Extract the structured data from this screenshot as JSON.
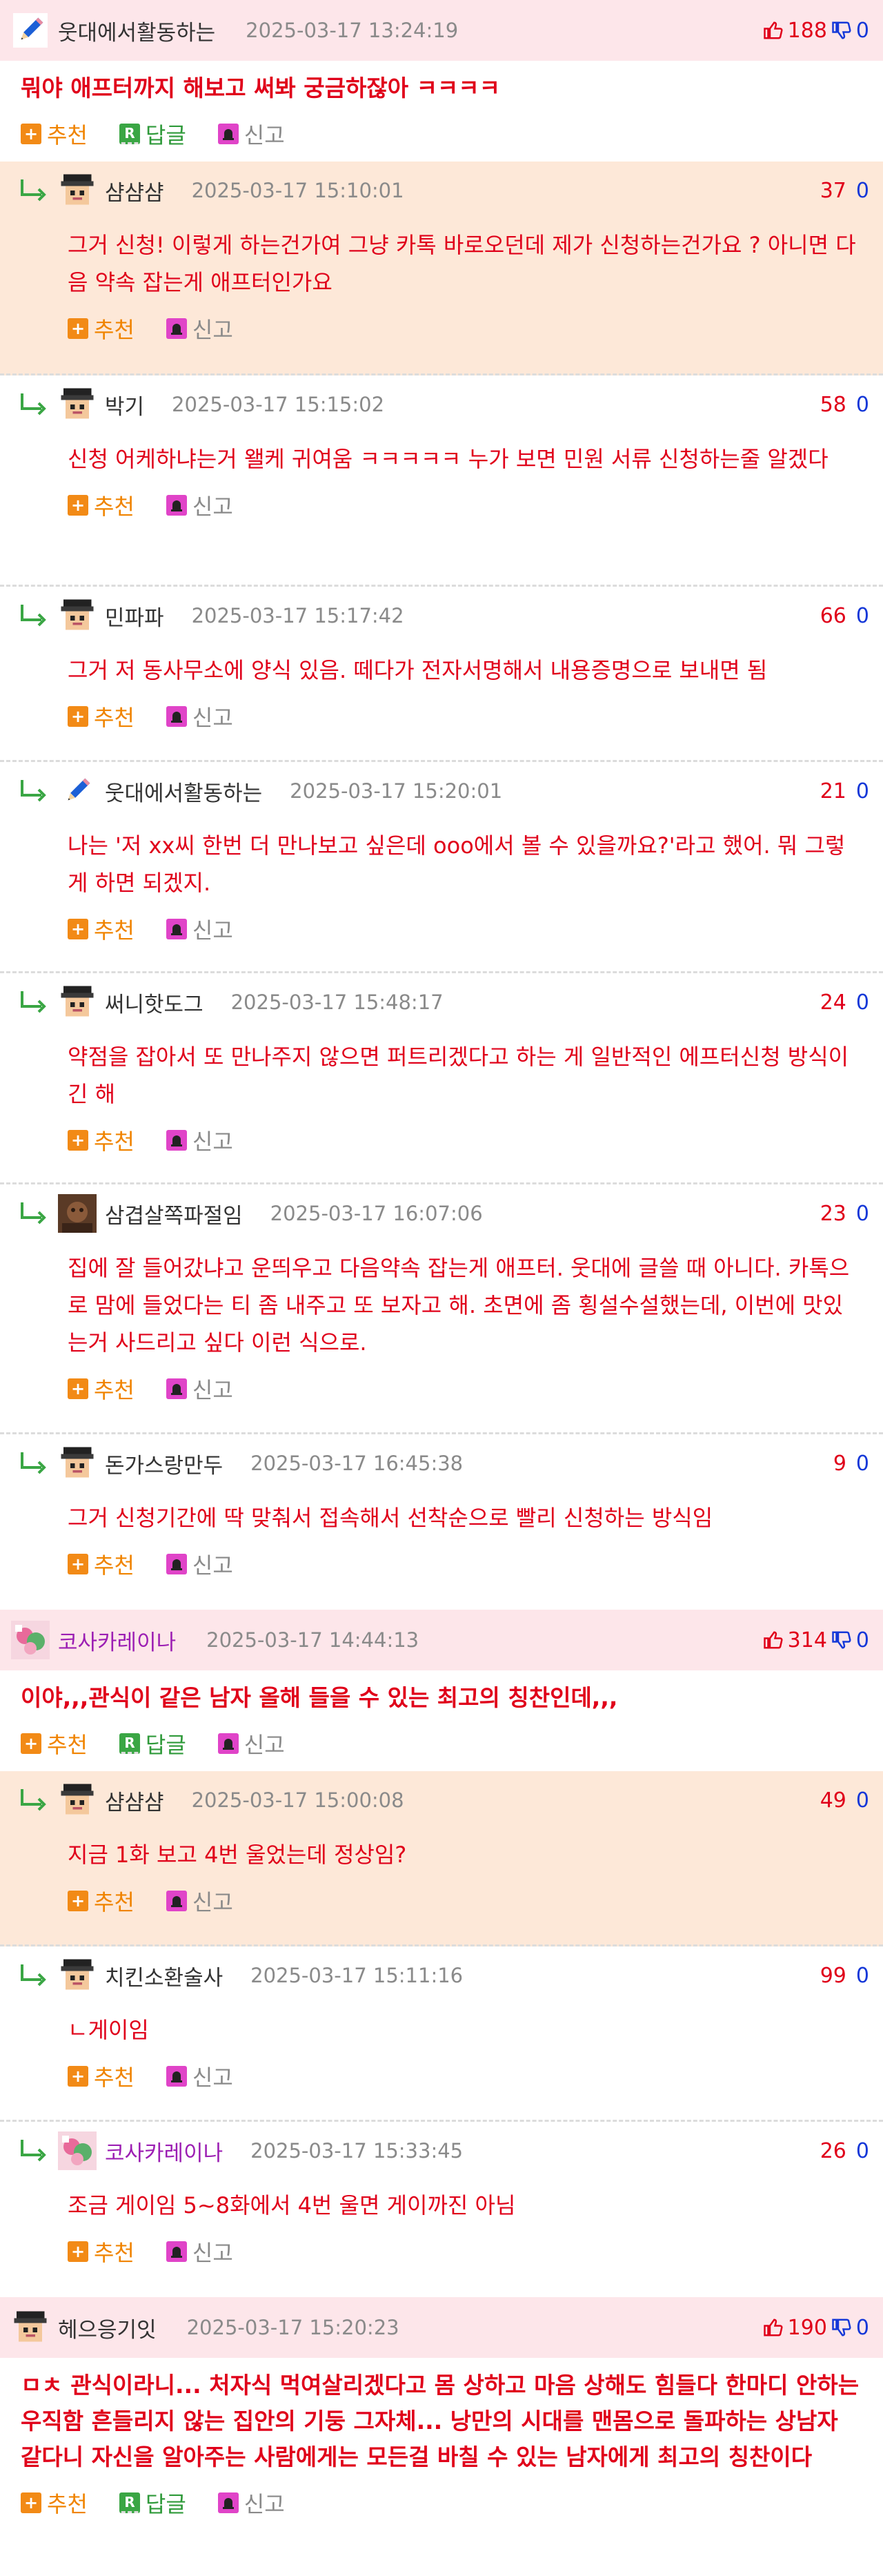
{
  "labels": {
    "recommend": "추천",
    "reply": "답글",
    "report": "신고",
    "reply_icon": "R"
  },
  "threads": [
    {
      "nick": "웃대에서활동하는",
      "date": "2025-03-17 13:24:19",
      "up": "188",
      "down": "0",
      "avatar_icon": "pencil-icon",
      "text": "뭐야 애프터까지 해보고 써봐 궁금하잖아 ㅋㅋㅋㅋ",
      "replies": [
        {
          "nick": "샴샴샴",
          "date": "2025-03-17 15:10:01",
          "up": "37",
          "down": "0",
          "avatar_icon": "pixel-face-icon",
          "text": "그거 신청! 이렇게 하는건가여 그냥 카톡 바로오던데 제가 신청하는건가요 ? 아니면 다음 약속 잡는게 애프터인가요"
        },
        {
          "nick": "박기",
          "date": "2025-03-17 15:15:02",
          "up": "58",
          "down": "0",
          "avatar_icon": "pixel-face-icon",
          "text": "신청 어케하냐는거 왤케 귀여움 ㅋㅋㅋㅋㅋ 누가 보면 민원 서류 신청하는줄 알겠다"
        },
        {
          "nick": "민파파",
          "date": "2025-03-17 15:17:42",
          "up": "66",
          "down": "0",
          "avatar_icon": "pixel-face-icon",
          "text": "그거 저 동사무소에 양식 있음. 떼다가 전자서명해서 내용증명으로 보내면 됨"
        },
        {
          "nick": "웃대에서활동하는",
          "date": "2025-03-17 15:20:01",
          "up": "21",
          "down": "0",
          "avatar_icon": "pencil-icon",
          "text": "나는 '저 xx씨 한번 더 만나보고 싶은데 ooo에서 볼 수 있을까요?'라고 했어. 뭐 그렇게 하면 되겠지."
        },
        {
          "nick": "써니핫도그",
          "date": "2025-03-17 15:48:17",
          "up": "24",
          "down": "0",
          "avatar_icon": "pixel-face-icon",
          "text": "약점을 잡아서 또 만나주지 않으면 퍼트리겠다고 하는 게 일반적인 에프터신청 방식이긴 해"
        },
        {
          "nick": "삼겹살쪽파절임",
          "date": "2025-03-17 16:07:06",
          "up": "23",
          "down": "0",
          "avatar_icon": "photo-avatar-icon",
          "text": "집에 잘 들어갔냐고 운띄우고 다음약속 잡는게 애프터. 웃대에 글쓸 때 아니다. 카톡으로 맘에 들었다는 티 좀 내주고 또 보자고 해. 초면에 좀 횡설수설했는데, 이번에 맛있는거 사드리고 싶다 이런 식으로."
        },
        {
          "nick": "돈가스랑만두",
          "date": "2025-03-17 16:45:38",
          "up": "9",
          "down": "0",
          "avatar_icon": "pixel-face-icon",
          "text": "그거 신청기간에 딱 맞춰서 접속해서 선착순으로 빨리 신청하는 방식임"
        }
      ]
    },
    {
      "nick": "코사카레이나",
      "date": "2025-03-17 14:44:13",
      "up": "314",
      "down": "0",
      "avatar_icon": "anime-avatar-icon",
      "text": "이야,,,관식이 같은 남자 올해 들을 수 있는 최고의 칭찬인데,,,",
      "replies": [
        {
          "nick": "샴샴샴",
          "date": "2025-03-17 15:00:08",
          "up": "49",
          "down": "0",
          "avatar_icon": "pixel-face-icon",
          "text": "지금 1화 보고 4번 울었는데 정상임?"
        },
        {
          "nick": "치킨소환술사",
          "date": "2025-03-17 15:11:16",
          "up": "99",
          "down": "0",
          "avatar_icon": "pixel-face-icon",
          "text": "ㄴ게이임"
        },
        {
          "nick": "코사카레이나",
          "date": "2025-03-17 15:33:45",
          "up": "26",
          "down": "0",
          "avatar_icon": "anime-avatar-icon",
          "text": "조금 게이임 5~8화에서 4번 울면 게이까진 아님"
        }
      ]
    },
    {
      "nick": "헤으응기잇",
      "date": "2025-03-17 15:20:23",
      "up": "190",
      "down": "0",
      "avatar_icon": "pixel-face-icon",
      "text": "ㅁㅊ 관식이라니... 처자식 먹여살리겠다고 몸 상하고 마음 상해도 힘들다 한마디 안하는 우직함 흔들리지 않는 집안의 기둥 그자체... 낭만의 시대를 맨몸으로 돌파하는 상남자 같다니 자신을 알아주는 사람에게는 모든걸 바칠 수 있는 남자에게 최고의 칭찬이다",
      "replies": []
    }
  ]
}
